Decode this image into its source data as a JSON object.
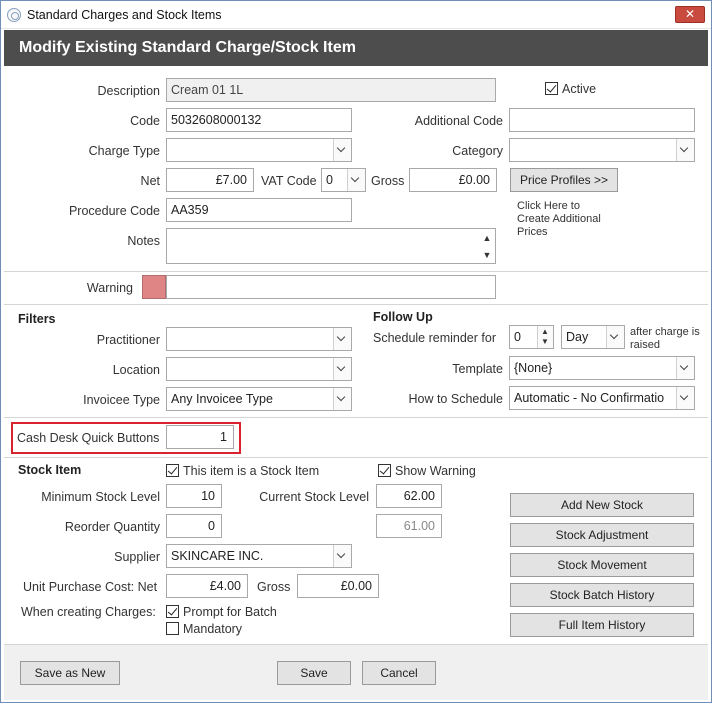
{
  "window": {
    "title": "Standard Charges and Stock Items",
    "close_label": "✕"
  },
  "header": {
    "title": "Modify Existing Standard Charge/Stock Item"
  },
  "form": {
    "description_label": "Description",
    "description_value": "Cream 01 1L",
    "active_label": "Active",
    "active_checked": true,
    "code_label": "Code",
    "code_value": "5032608000132",
    "additional_code_label": "Additional Code",
    "additional_code_value": "",
    "charge_type_label": "Charge Type",
    "charge_type_value": "",
    "category_label": "Category",
    "category_value": "",
    "net_label": "Net",
    "net_value": "£7.00",
    "vat_code_label": "VAT Code",
    "vat_code_value": "0",
    "gross_label": "Gross",
    "gross_value": "£0.00",
    "price_profiles_button": "Price Profiles >>",
    "price_profiles_hint": [
      "Click Here to",
      "Create Additional",
      "Prices"
    ],
    "procedure_code_label": "Procedure Code",
    "procedure_code_value": "AA359",
    "notes_label": "Notes",
    "notes_value": "",
    "warning_label": "Warning",
    "warning_value": "",
    "warning_color": "#e08585"
  },
  "filters": {
    "heading": "Filters",
    "practitioner_label": "Practitioner",
    "practitioner_value": "",
    "location_label": "Location",
    "location_value": "",
    "invoicee_type_label": "Invoicee Type",
    "invoicee_type_value": "Any Invoicee Type"
  },
  "follow_up": {
    "heading": "Follow Up",
    "schedule_reminder_label": "Schedule reminder for",
    "schedule_reminder_value": "0",
    "period_value": "Day",
    "after_charge_hint": [
      "after charge is",
      "raised"
    ],
    "template_label": "Template",
    "template_value": "{None}",
    "how_to_schedule_label": "How to Schedule",
    "how_to_schedule_value": "Automatic - No Confirmatio"
  },
  "cash_desk": {
    "label": "Cash Desk Quick Buttons",
    "value": "1",
    "highlight_color": "#d9232d"
  },
  "stock": {
    "heading": "Stock Item",
    "is_stock_label": "This item is a Stock Item",
    "is_stock_checked": true,
    "show_warning_label": "Show Warning",
    "show_warning_checked": true,
    "min_level_label": "Minimum Stock Level",
    "min_level_value": "10",
    "current_level_label": "Current Stock Level",
    "current_level_value": "62.00",
    "reorder_qty_label": "Reorder Quantity",
    "reorder_qty_value": "0",
    "secondary_level_value": "61.00",
    "supplier_label": "Supplier",
    "supplier_value": "SKINCARE INC.",
    "unit_cost_label": "Unit Purchase Cost: Net",
    "unit_cost_net_value": "£4.00",
    "unit_cost_gross_label": "Gross",
    "unit_cost_gross_value": "£0.00",
    "when_creating_label": "When creating Charges:",
    "prompt_batch_label": "Prompt for Batch",
    "prompt_batch_checked": true,
    "mandatory_label": "Mandatory",
    "mandatory_checked": false,
    "buttons": {
      "add_new_stock": "Add New Stock",
      "stock_adjustment": "Stock Adjustment",
      "stock_movement": "Stock Movement",
      "stock_batch_history": "Stock Batch History",
      "full_item_history": "Full Item History"
    }
  },
  "footer": {
    "save_as_new": "Save as New",
    "save": "Save",
    "cancel": "Cancel"
  }
}
